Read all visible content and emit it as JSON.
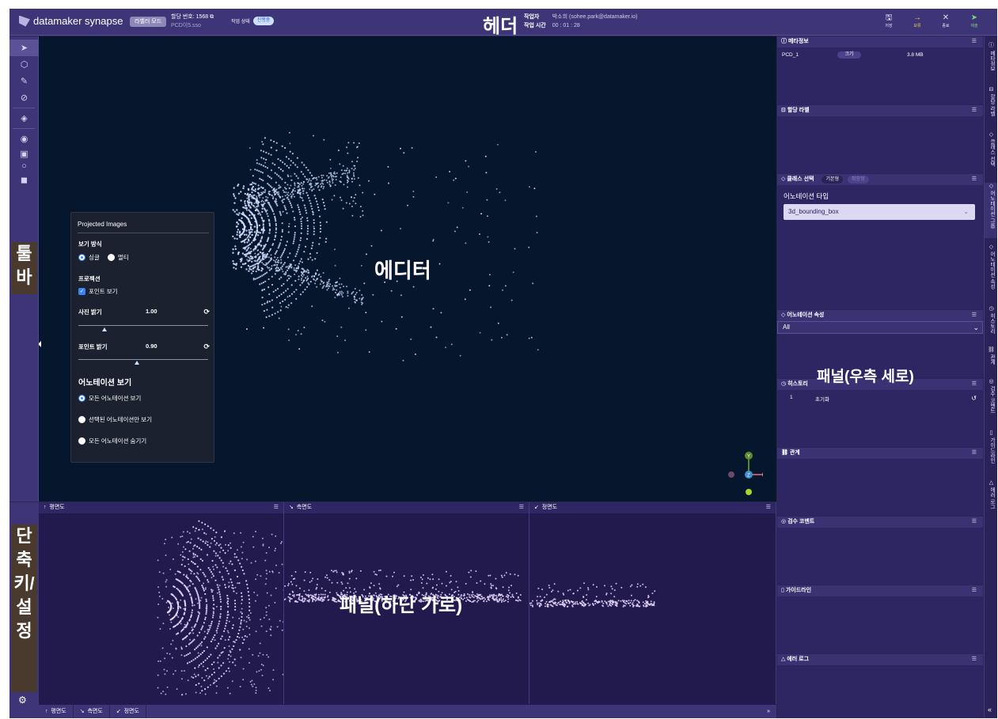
{
  "header": {
    "brand": "datamaker synapse",
    "mode_badge": "라벨러 모드",
    "assign_no_label": "할당 번호: 1568",
    "assign_sub": "PCD이5.sso",
    "work_status_label": "작업 상태",
    "work_status_value": "진행중",
    "title": "헤더",
    "worker_label": "작업자",
    "worker_value": "박소희 (sohee.park@datamaker.io)",
    "time_label": "작업 시간",
    "time_value": "00 : 01 : 28",
    "actions": [
      {
        "label": "저장",
        "icon": "save-icon",
        "glyph": "🖫"
      },
      {
        "label": "보류",
        "icon": "arrow-right-icon",
        "glyph": "→"
      },
      {
        "label": "종료",
        "icon": "close-icon",
        "glyph": "✕"
      },
      {
        "label": "제출",
        "icon": "send-icon",
        "glyph": "➤"
      }
    ]
  },
  "toolbar": {
    "label": "툴바",
    "tools": [
      {
        "name": "select-tool",
        "glyph": "➤"
      },
      {
        "name": "cuboid-tool",
        "glyph": "⬡"
      },
      {
        "name": "pen-tool",
        "glyph": "✎"
      },
      {
        "name": "lasso-tool",
        "glyph": "⊘"
      },
      {
        "name": "point-tool",
        "glyph": "◈"
      },
      {
        "name": "palette-tool",
        "glyph": "◉"
      },
      {
        "name": "image-tool",
        "glyph": "▣"
      },
      {
        "name": "circle-tool",
        "glyph": "○"
      },
      {
        "name": "box-tool",
        "glyph": "◼"
      }
    ]
  },
  "editor": {
    "label": "에디터",
    "projected_images": {
      "title": "Projected Images",
      "view_mode_label": "보기 방식",
      "view_single": "싱글",
      "view_multi": "멀티",
      "projection_label": "프로젝션",
      "point_view": "포인트 보기",
      "photo_brightness_label": "사진 밝기",
      "photo_brightness_value": "1.00",
      "photo_brightness_level": 0.2,
      "point_brightness_label": "포인트 밝기",
      "point_brightness_value": "0.90",
      "point_brightness_level": 0.45,
      "annotation_view_title": "어노테이션 보기",
      "annotation_options": [
        "모든 어노테이션 보기",
        "선택된 어노테이션만 보기",
        "모든 어노테이션 숨기기"
      ]
    },
    "gizmo": {
      "y": "Y",
      "z": "Z",
      "x": "X"
    }
  },
  "bottom": {
    "label": "패널(하단 가로)",
    "views": [
      "평면도",
      "측면도",
      "정면도"
    ],
    "tabs": [
      "평면도",
      "측면도",
      "정면도"
    ],
    "expand": "»"
  },
  "shortcut": {
    "label": "단축키/설정"
  },
  "panel": {
    "label": "패널(우측 세로)",
    "meta": {
      "title": "메타정보",
      "file": "PCD_1",
      "size_label": "크기",
      "size_value": "3.8 MB"
    },
    "assign_label": {
      "title": "할당 라벨"
    },
    "class_select": {
      "title": "클래스 선택",
      "tab_basic": "기본형",
      "tab_other": "확장형",
      "anno_type_label": "어노테이션 타입",
      "anno_type_value": "3d_bounding_box"
    },
    "anno_attr": {
      "title": "어노테이션 속성",
      "value": "All"
    },
    "history": {
      "title": "히스토리",
      "rows": [
        {
          "no": "1",
          "action": "초기화"
        }
      ]
    },
    "relation": {
      "title": "관계"
    },
    "review": {
      "title": "검수 코멘트"
    },
    "guide": {
      "title": "가이드라인"
    },
    "error_log": {
      "title": "에러 로그"
    }
  },
  "vtabs": [
    {
      "label": "메타정보",
      "glyph": "ⓘ"
    },
    {
      "label": "할당 라벨",
      "glyph": "⊟"
    },
    {
      "label": "클래스 선택",
      "glyph": "◇"
    },
    {
      "label": "어노테이션 그룹",
      "glyph": "◇"
    },
    {
      "label": "어노테이션 속성",
      "glyph": "◇"
    },
    {
      "label": "히스토리",
      "glyph": "◷"
    },
    {
      "label": "관계",
      "glyph": "⛓"
    },
    {
      "label": "검수 코멘트",
      "glyph": "◎"
    },
    {
      "label": "가이드라인",
      "glyph": "▯"
    },
    {
      "label": "에러 로그",
      "glyph": "△"
    }
  ],
  "colors": {
    "accent": "#3d3577",
    "editor_bg": "#06162d",
    "points": "#cfd8ff",
    "bottom_points": "#e6d8ff"
  }
}
